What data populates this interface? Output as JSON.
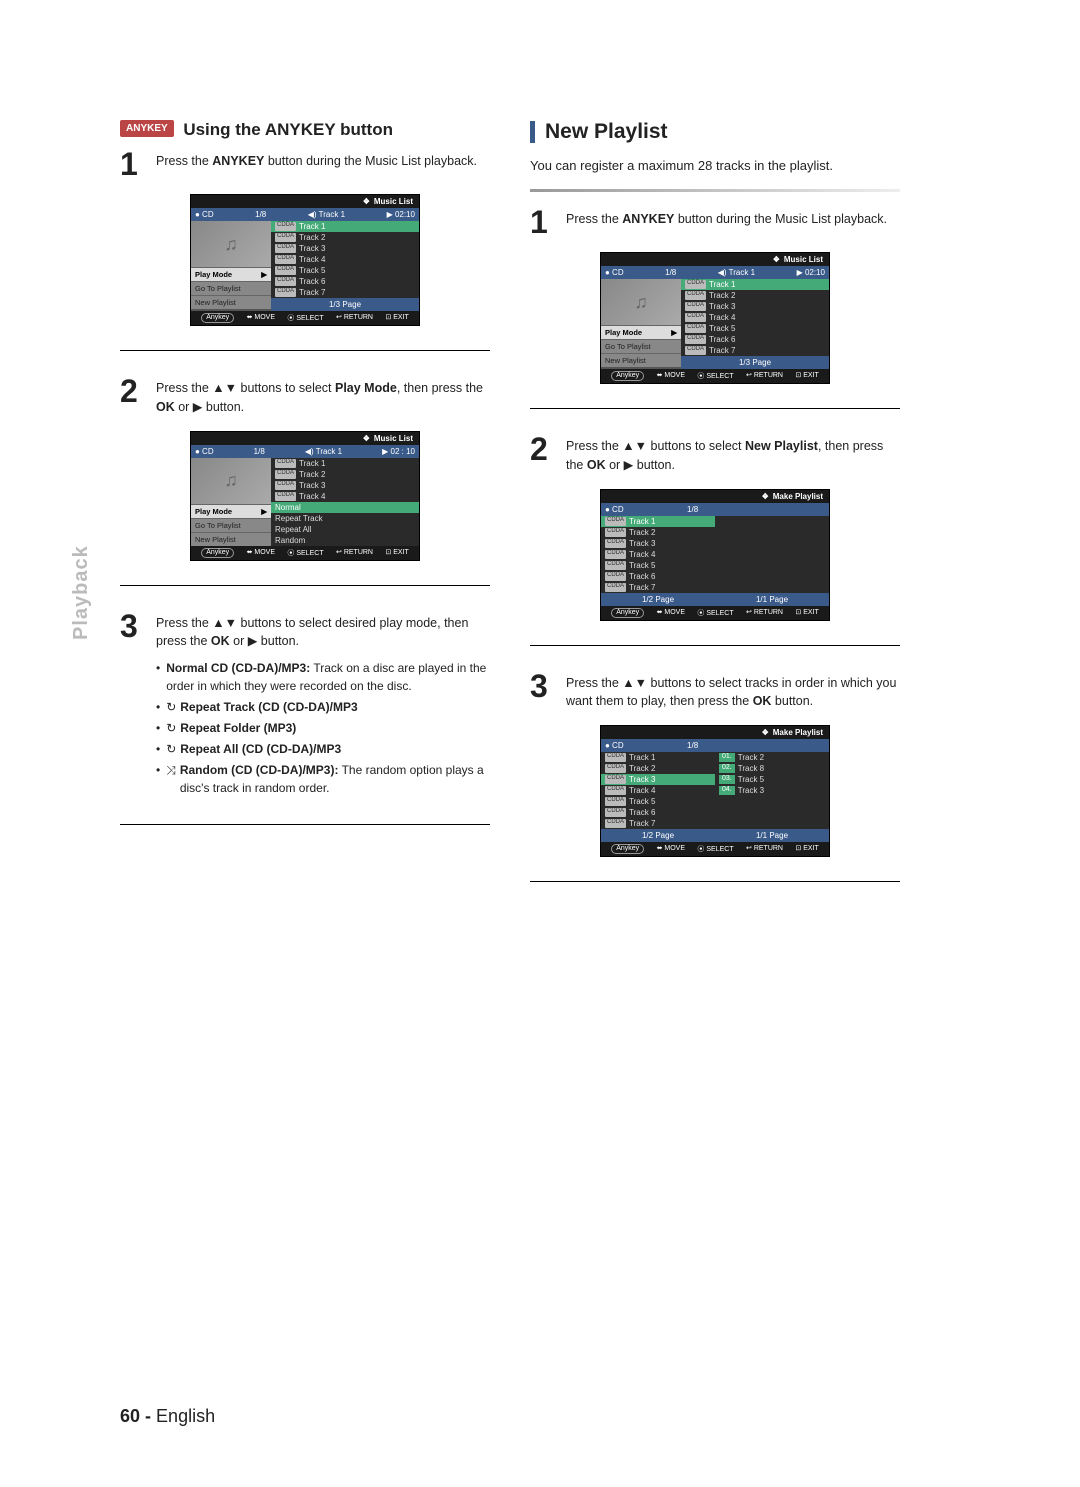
{
  "sideLabel": "Playback",
  "left": {
    "badge": "ANYKEY",
    "heading": "Using the ANYKEY button",
    "step1": {
      "pre": "Press the ",
      "bold": "ANYKEY",
      "post": " button during the Music List playback."
    },
    "step2": {
      "pre": "Press the ▲▼ buttons to select ",
      "bold": "Play Mode",
      "mid": ", then press the ",
      "bold2": "OK",
      "post": " or ▶ button."
    },
    "step3": {
      "pre": "Press the ▲▼ buttons to select desired play mode, then press the ",
      "bold": "OK",
      "post": " or ▶ button."
    },
    "bullets": [
      {
        "bold": "Normal CD (CD-DA)/MP3:",
        "text": " Track on a disc are played in the order in which they were recorded on the disc."
      },
      {
        "icon": "↻",
        "bold": "Repeat Track (CD (CD-DA)/MP3",
        "text": ""
      },
      {
        "icon": "↻",
        "bold": "Repeat Folder (MP3)",
        "text": ""
      },
      {
        "icon": "↻",
        "bold": "Repeat All (CD (CD-DA)/MP3",
        "text": ""
      },
      {
        "icon": "⤨",
        "bold": "Random (CD (CD-DA)/MP3):",
        "text": " The random option plays a disc's track in random order."
      }
    ]
  },
  "right": {
    "heading": "New Playlist",
    "intro": "You can register a maximum 28 tracks in the playlist.",
    "step1": {
      "pre": "Press the ",
      "bold": "ANYKEY",
      "post": " button during the Music List playback."
    },
    "step2": {
      "pre": "Press the ▲▼ buttons to select ",
      "bold": "New Playlist",
      "mid": ", then press the ",
      "bold2": "OK",
      "post": " or ▶ button."
    },
    "step3": {
      "pre": "Press the ▲▼ buttons to select tracks in order in which you want them to play, then press the ",
      "bold": "OK",
      "post": " button."
    }
  },
  "ui": {
    "title_music": "Music List",
    "title_make": "Make Playlist",
    "header": {
      "disc": "●  CD",
      "count": "1/8",
      "nowplaying": "◀)  Track  1",
      "time": "▶ 02:10",
      "time2": "▶ 02 : 10"
    },
    "menu": {
      "playmode": "Play Mode",
      "goto": "Go To Playlist",
      "newpl": "New Playlist",
      "arrow": "▶"
    },
    "tracks": [
      "Track 1",
      "Track 2",
      "Track 3",
      "Track 4",
      "Track 5",
      "Track 6",
      "Track 7"
    ],
    "badge": "CDDA",
    "subopts": [
      "Normal",
      "Repeat Track",
      "Repeat All",
      "Random"
    ],
    "page13": "1/3 Page",
    "page12": "1/2 Page",
    "page11": "1/1 Page",
    "footer": {
      "anykey": "Anykey",
      "move": "⬌ MOVE",
      "select": "⦿ SELECT",
      "return": "↩ RETURN",
      "exit": "⊡ EXIT"
    },
    "make_slots": [
      {
        "n": "01.",
        "t": "Track 2"
      },
      {
        "n": "02.",
        "t": "Track 8"
      },
      {
        "n": "03.",
        "t": "Track 5"
      },
      {
        "n": "04.",
        "t": "Track 3"
      }
    ]
  },
  "footer": {
    "page": "60 -",
    "lang": "English"
  }
}
